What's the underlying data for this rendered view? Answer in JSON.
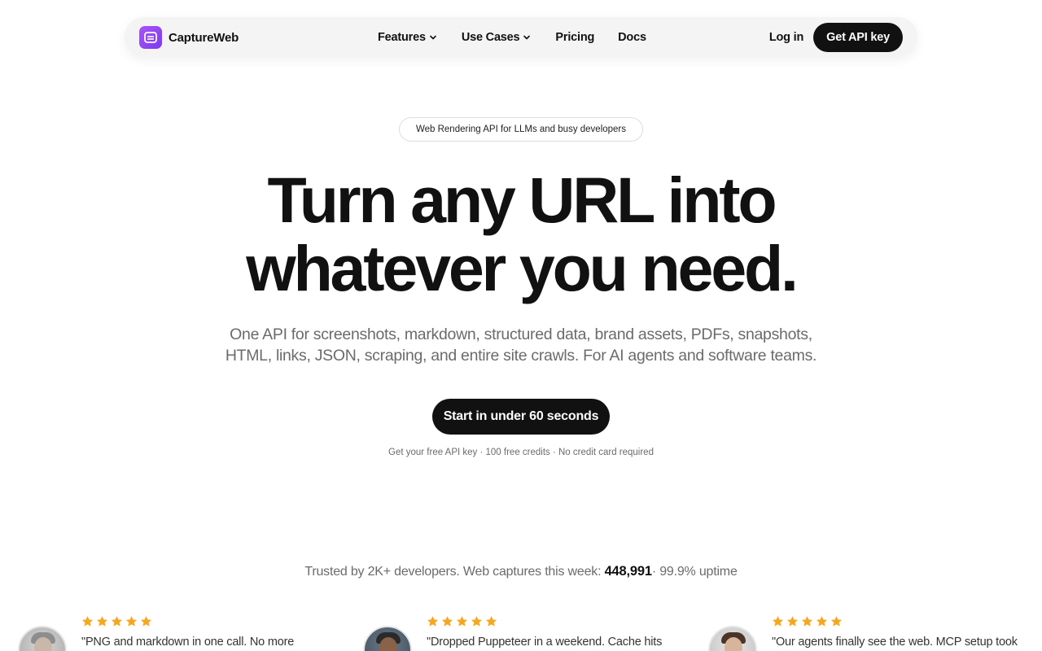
{
  "nav": {
    "brand_name": "CaptureWeb",
    "links": {
      "features": "Features",
      "use_cases": "Use Cases",
      "pricing": "Pricing",
      "docs": "Docs"
    },
    "login_label": "Log in",
    "api_key_label": "Get API key"
  },
  "hero": {
    "badge": "Web Rendering API for LLMs and busy developers",
    "headline_line1": "Turn any URL into",
    "headline_line2": "whatever you need.",
    "subhead_line1": "One API for screenshots, markdown, structured data, brand assets, PDFs, snapshots,",
    "subhead_line2": "HTML, links, JSON, scraping, and entire site crawls. For AI agents and software teams.",
    "cta_label": "Start in under 60 seconds",
    "cta_note": "Get your free API key · 100 free credits · No credit card required"
  },
  "trust": {
    "prefix": "Trusted by 2K+ developers. Web captures this week: ",
    "count": "448,991",
    "suffix": "· 99.9% uptime"
  },
  "testimonials": [
    {
      "rating": 5,
      "quote": "\"PNG and markdown in one call. No more"
    },
    {
      "rating": 5,
      "quote": "\"Dropped Puppeteer in a weekend. Cache hits"
    },
    {
      "rating": 5,
      "quote": "\"Our agents finally see the web. MCP setup took"
    }
  ],
  "colors": {
    "brand_gradient_start": "#a855f7",
    "brand_gradient_end": "#7c3aed",
    "primary_button": "#111111",
    "star": "#f5a623",
    "muted_text": "#6b6b6b"
  }
}
